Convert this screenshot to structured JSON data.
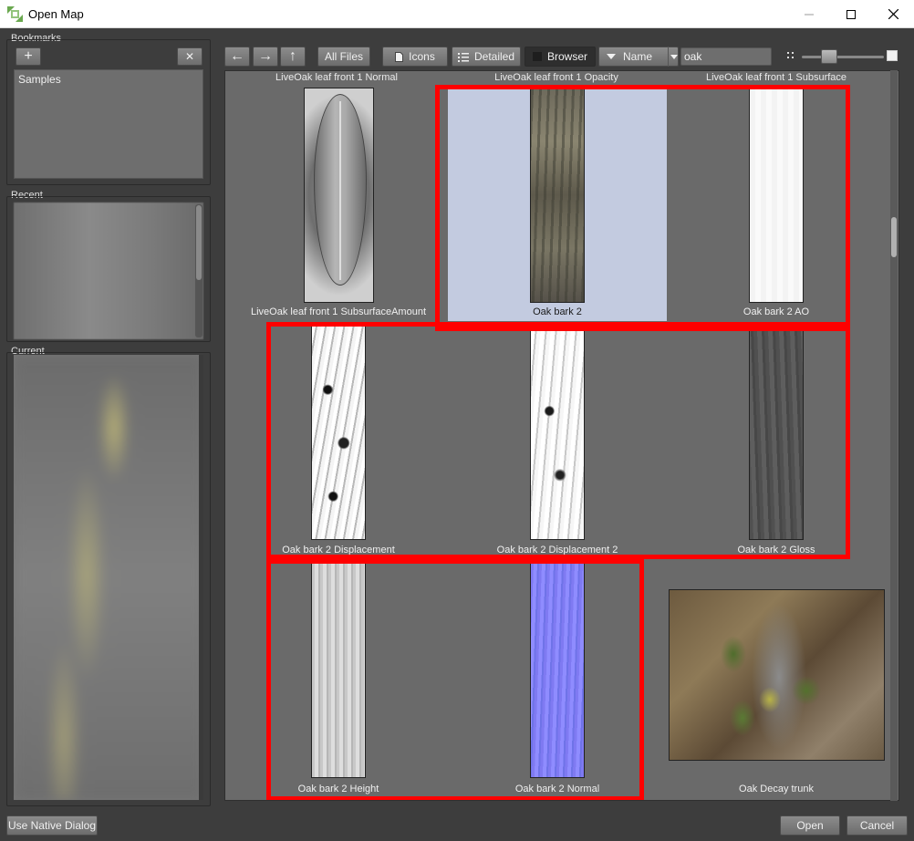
{
  "window": {
    "title": "Open Map"
  },
  "left": {
    "bookmarks_label": "Bookmarks",
    "add_label": "+",
    "remove_label": "✕",
    "bookmarks": [
      "Samples"
    ],
    "recent_label": "Recent",
    "current_label": "Current"
  },
  "toolbar": {
    "back": "←",
    "forward": "→",
    "up": "↑",
    "all_files": "All Files",
    "icons": "Icons",
    "detailed": "Detailed",
    "browser": "Browser",
    "sort": "Name",
    "search_value": "oak"
  },
  "top_row_labels": [
    "LiveOak leaf front 1 Normal",
    "LiveOak leaf front 1 Opacity",
    "LiveOak leaf front 1 Subsurface"
  ],
  "tiles": [
    "LiveOak leaf front 1 SubsurfaceAmount",
    "Oak bark 2",
    "Oak bark 2 AO",
    "Oak bark 2 Displacement",
    "Oak bark 2 Displacement 2",
    "Oak bark 2 Gloss",
    "Oak bark 2 Height",
    "Oak bark 2 Normal",
    "Oak Decay trunk"
  ],
  "bottom": {
    "native_dialog": "Use Native Dialog",
    "open": "Open",
    "cancel": "Cancel"
  },
  "colors": {
    "highlight": "#ff0000",
    "selection": "#c3cbe0"
  }
}
